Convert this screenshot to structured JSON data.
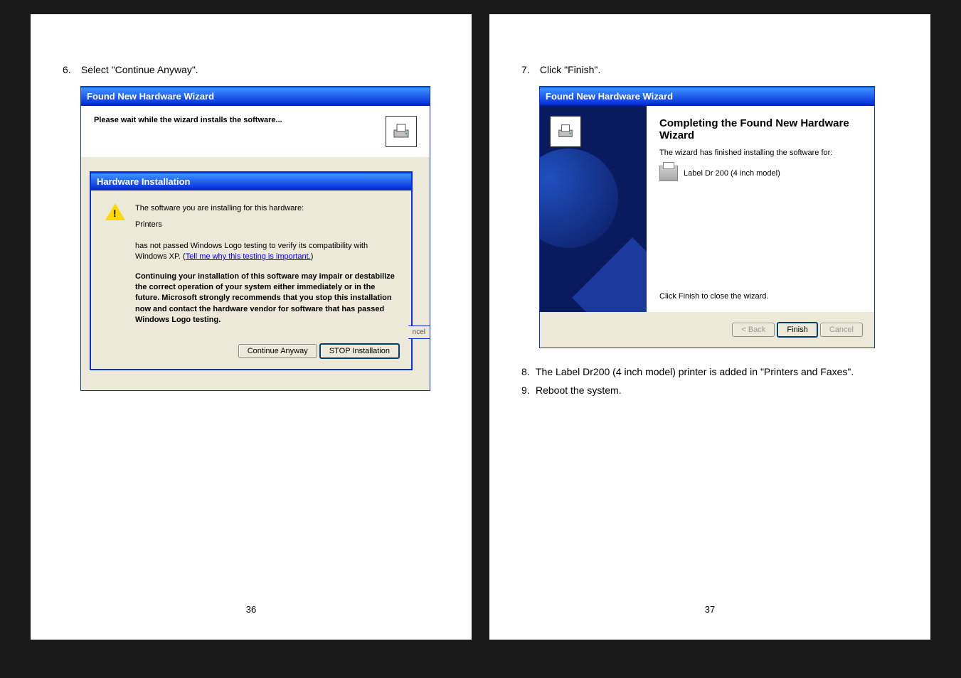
{
  "left": {
    "instruction_num": "6.",
    "instruction_text": "Select \"Continue Anyway\".",
    "outer_title": "Found New Hardware Wizard",
    "outer_heading": "Please wait while the wizard installs the software...",
    "inner_title": "Hardware Installation",
    "hw_line1": "The software you are installing for this hardware:",
    "hw_device": "Printers",
    "hw_line2a": "has not passed Windows Logo testing to verify its compatibility with Windows XP. (",
    "hw_link": "Tell me why this testing is important.",
    "hw_line2b": ")",
    "hw_bold": "Continuing your installation of this software may impair or destabilize the correct operation of your system either immediately or in the future. Microsoft strongly recommends that you stop this installation now and contact the hardware vendor for software that has passed Windows Logo testing.",
    "btn_continue": "Continue Anyway",
    "btn_stop": "STOP Installation",
    "peek": "ncel",
    "page_num": "36"
  },
  "right": {
    "instruction_num": "7.",
    "instruction_text": "Click \"Finish\".",
    "title": "Found New Hardware Wizard",
    "heading": "Completing the Found New Hardware Wizard",
    "sub": "The wizard has finished installing the software for:",
    "device": "Label Dr 200 (4 inch model)",
    "foot": "Click Finish to close the wizard.",
    "btn_back": "< Back",
    "btn_finish": "Finish",
    "btn_cancel": "Cancel",
    "f8n": "8.",
    "f8": "The Label Dr200 (4 inch model) printer is added in \"Printers and Faxes\".",
    "f9n": "9.",
    "f9": "Reboot the system.",
    "page_num": "37"
  }
}
